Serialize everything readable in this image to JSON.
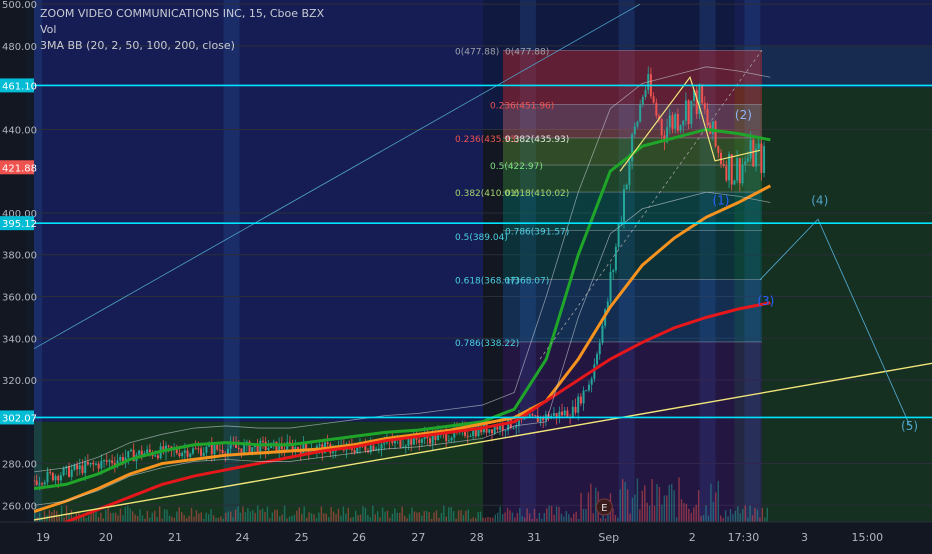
{
  "header": {
    "symbol_line": "ZOOM VIDEO COMMUNICATIONS INC, 15, Cboe BZX",
    "volume_label": "Vol",
    "indicator_label": "3MA BB (20, 2, 50, 100, 200, close)"
  },
  "colors": {
    "background": "#131722",
    "candle_up": "#26a69a",
    "candle_down": "#ef5350",
    "ma_short": "#1fa62a",
    "ma_mid": "#f7931e",
    "ma_long": "#e5171b",
    "trendline": "#f2e57a",
    "hline": "#00e5ff",
    "fib": "#d6d6d6"
  },
  "chart_data": {
    "type": "candlestick",
    "title": "ZOOM VIDEO COMMUNICATIONS INC, 15, Cboe BZX",
    "x_tick_labels": [
      "19",
      "20",
      "21",
      "24",
      "25",
      "26",
      "27",
      "28",
      "31",
      "Sep",
      "2",
      "17:30",
      "3",
      "15:00"
    ],
    "y_tick_labels": [
      "500.00",
      "480.00",
      "440.00",
      "400.00",
      "380.00",
      "360.00",
      "340.00",
      "320.00",
      "280.00",
      "260.00"
    ],
    "y_ticks": [
      500,
      480,
      440,
      400,
      380,
      360,
      340,
      320,
      280,
      260
    ],
    "ylim": [
      252,
      502
    ],
    "price_badges": [
      {
        "label": "461.10",
        "value": 461.1,
        "color": "#00bcd4"
      },
      {
        "label": "421.88",
        "value": 421.88,
        "color": "#ef5350"
      },
      {
        "label": "395.12",
        "value": 395.12,
        "color": "#00bcd4"
      },
      {
        "label": "302.07",
        "value": 302.07,
        "color": "#00bcd4"
      }
    ],
    "horizontal_levels": [
      461.1,
      395.12,
      302.07
    ],
    "fib_labels": [
      {
        "text": "0(477.88)",
        "value": 477.88,
        "x": 0.0,
        "color": "#9fa3ad"
      },
      {
        "text": "0(477.88)",
        "value": 477.88,
        "x": 1.0,
        "color": "#9fa3ad"
      },
      {
        "text": "0.236(451.96)",
        "value": 451.96,
        "x": 0.5,
        "color": "#ef5350"
      },
      {
        "text": "0.236(435.93)",
        "value": 435.93,
        "x": 0.0,
        "color": "#ef5350"
      },
      {
        "text": "0.382(435.93)",
        "value": 435.93,
        "x": 0.6,
        "color": "#e8e8e8"
      },
      {
        "text": "0.5(422.97)",
        "value": 422.97,
        "x": 0.5,
        "color": "#7ee27e"
      },
      {
        "text": "0.382(410.01)",
        "value": 410.01,
        "x": 0.0,
        "color": "#a5d66b"
      },
      {
        "text": "0.618(410.02)",
        "value": 410.02,
        "x": 0.6,
        "color": "#a5d66b"
      },
      {
        "text": "0.786(391.57)",
        "value": 391.57,
        "x": 0.6,
        "color": "#4dd0e1"
      },
      {
        "text": "0.5(389.04)",
        "value": 389.04,
        "x": 0.0,
        "color": "#4dd0e1"
      },
      {
        "text": "0.618(368.07)",
        "value": 368.07,
        "x": 0.0,
        "color": "#4dd0e1"
      },
      {
        "text": "1(368.07)",
        "value": 368.07,
        "x": 0.6,
        "color": "#4dd0e1"
      },
      {
        "text": "0.786(338.22)",
        "value": 338.22,
        "x": 0.0,
        "color": "#4dd0e1"
      }
    ],
    "wave_labels": [
      {
        "text": "(5)",
        "x_index": 0.66,
        "value": 503,
        "color": "#2962ff"
      },
      {
        "text": "(2)",
        "x_index": 0.79,
        "value": 445,
        "color": "#8fb4ff"
      },
      {
        "text": "(1)",
        "x_index": 0.765,
        "value": 404,
        "color": "#2962ff"
      },
      {
        "text": "(4)",
        "x_index": 0.875,
        "value": 404,
        "color": "#4fa3c7"
      },
      {
        "text": "(3)",
        "x_index": 0.815,
        "value": 356,
        "color": "#2962ff"
      },
      {
        "text": "(5)",
        "x_index": 0.975,
        "value": 296,
        "color": "#4fa3c7"
      }
    ],
    "event_marker": {
      "text": "E",
      "x_index": 0.635
    },
    "series": [
      {
        "kind": "ma",
        "values": [
          268,
          270,
          275,
          282,
          286,
          289,
          290,
          289,
          289,
          291,
          293,
          295,
          296,
          298,
          300,
          306,
          330,
          380,
          420,
          432,
          436,
          440,
          438,
          435
        ]
      },
      {
        "kind": "ma",
        "values": [
          257,
          262,
          268,
          275,
          280,
          282,
          284,
          285,
          286,
          287,
          289,
          292,
          294,
          296,
          299,
          302,
          310,
          330,
          355,
          375,
          388,
          398,
          405,
          413
        ]
      },
      {
        "kind": "ma",
        "values": [
          247,
          252,
          258,
          264,
          270,
          274,
          277,
          280,
          283,
          286,
          288,
          291,
          293,
          295,
          297,
          300,
          310,
          320,
          330,
          338,
          345,
          350,
          354,
          357
        ]
      }
    ],
    "candle_range": {
      "start": 272,
      "end": 425
    }
  }
}
